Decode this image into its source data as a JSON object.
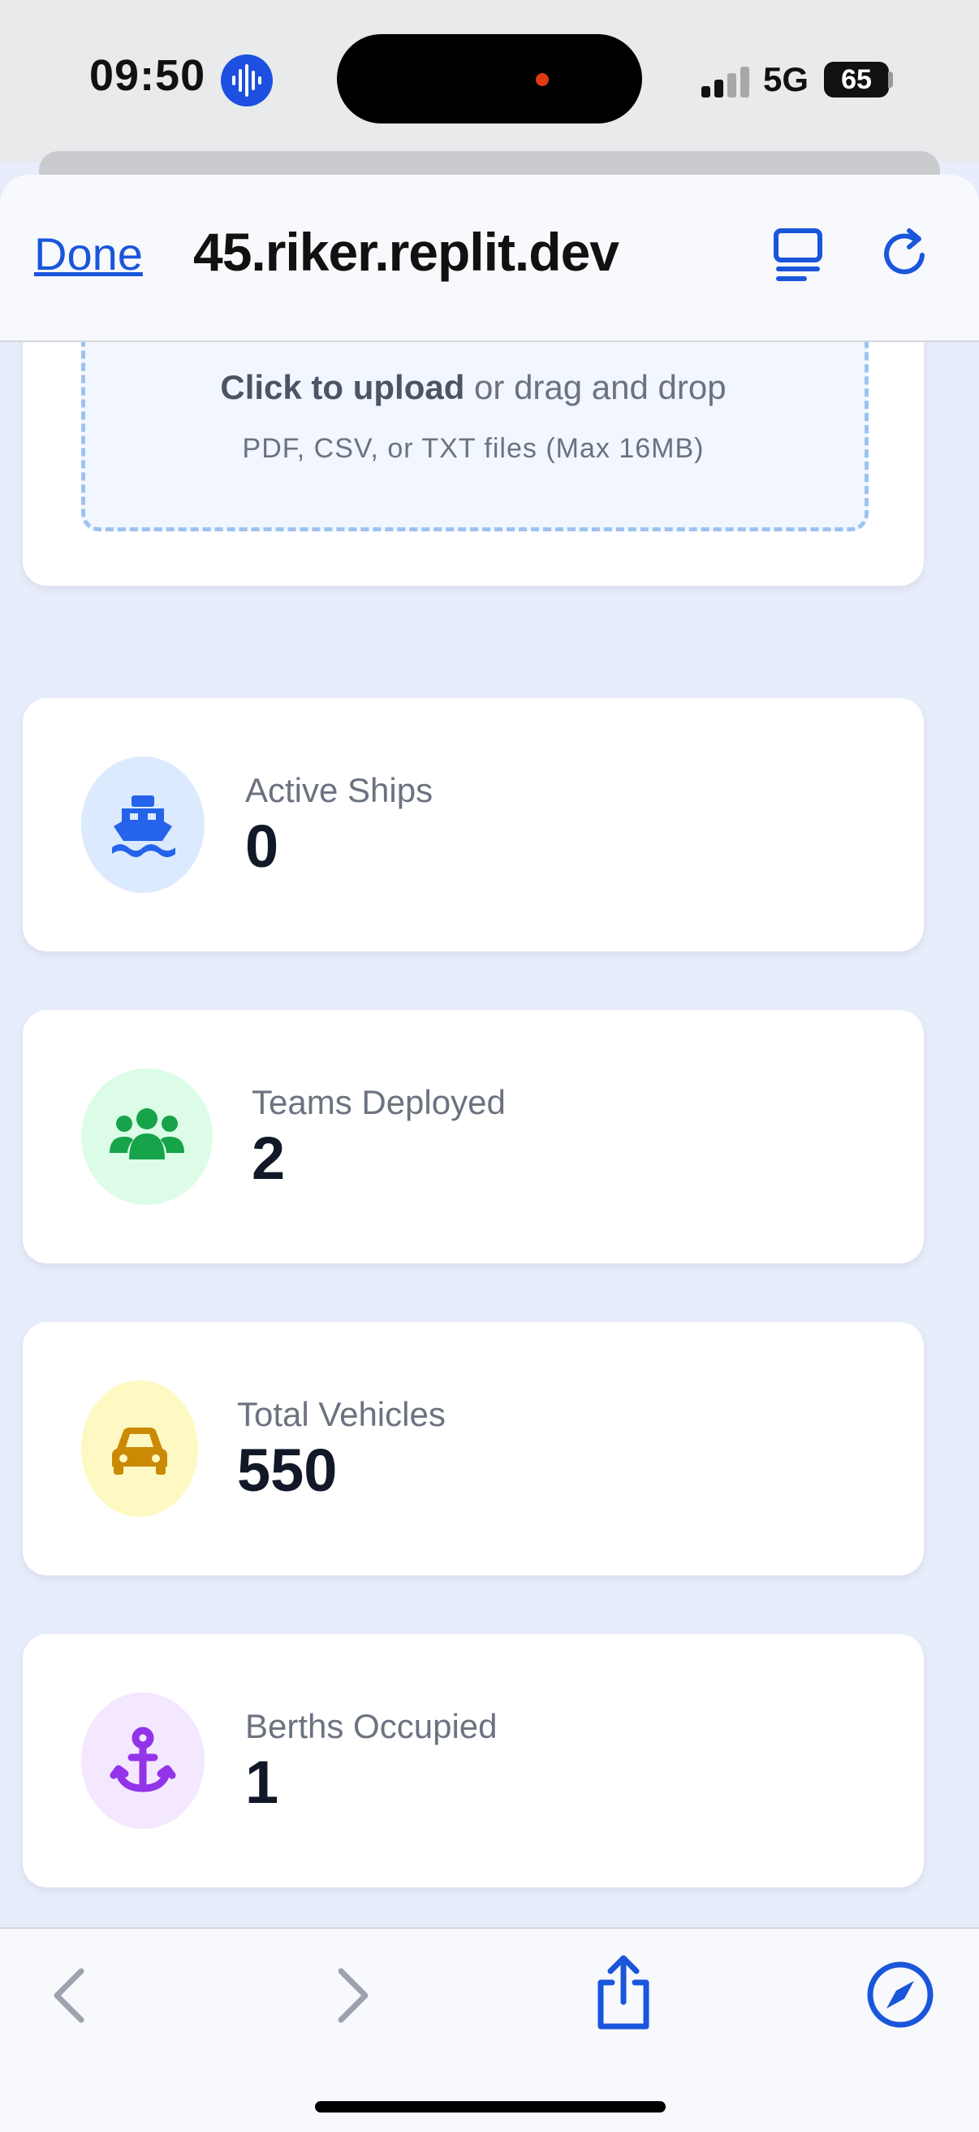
{
  "status_bar": {
    "time": "09:50",
    "network": "5G",
    "battery": "65"
  },
  "browser": {
    "done_label": "Done",
    "url": "45.riker.replit.dev"
  },
  "upload": {
    "title_bold": "Click to upload",
    "title_rest": " or drag and drop",
    "subtitle": "PDF, CSV, or TXT files (Max 16MB)"
  },
  "stats": [
    {
      "label": "Active Ships",
      "value": "0",
      "icon": "ship-icon",
      "bg": "#dbeafe",
      "color": "#2563eb"
    },
    {
      "label": "Teams Deployed",
      "value": "2",
      "icon": "team-icon",
      "bg": "#dcfce7",
      "color": "#16a34a"
    },
    {
      "label": "Total Vehicles",
      "value": "550",
      "icon": "car-icon",
      "bg": "#fef9c3",
      "color": "#ca8a04"
    },
    {
      "label": "Berths Occupied",
      "value": "1",
      "icon": "anchor-icon",
      "bg": "#f3e8ff",
      "color": "#9333ea"
    }
  ],
  "colors": {
    "accent": "#1a56db",
    "page_bg": "#e8edfb"
  }
}
